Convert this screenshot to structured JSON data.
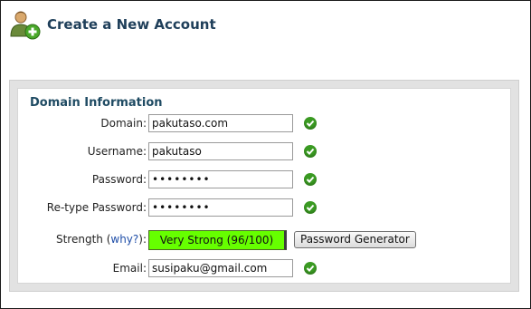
{
  "header": {
    "title": "Create a New Account",
    "icon": "add-user-icon"
  },
  "section": {
    "title": "Domain Information"
  },
  "form": {
    "domain": {
      "label": "Domain:",
      "value": "pakutaso.com",
      "valid": true
    },
    "username": {
      "label": "Username:",
      "value": "pakutaso",
      "valid": true
    },
    "password": {
      "label": "Password:",
      "value": "••••••••",
      "valid": true
    },
    "retype": {
      "label": "Re-type Password:",
      "value": "••••••••",
      "valid": true
    },
    "strength": {
      "label_prefix": "Strength (",
      "why_link": "why?",
      "label_suffix": "):",
      "meter_text": "Very Strong (96/100)",
      "score": 96,
      "max": 100,
      "color": "#66ff00"
    },
    "generator_button": "Password Generator",
    "email": {
      "label": "Email:",
      "value": "susipaku@gmail.com",
      "valid": true
    }
  },
  "colors": {
    "title": "#1f3f5a",
    "section_title": "#1f4b63",
    "valid_check": "#3a9a22",
    "link": "#1f4ea8"
  }
}
